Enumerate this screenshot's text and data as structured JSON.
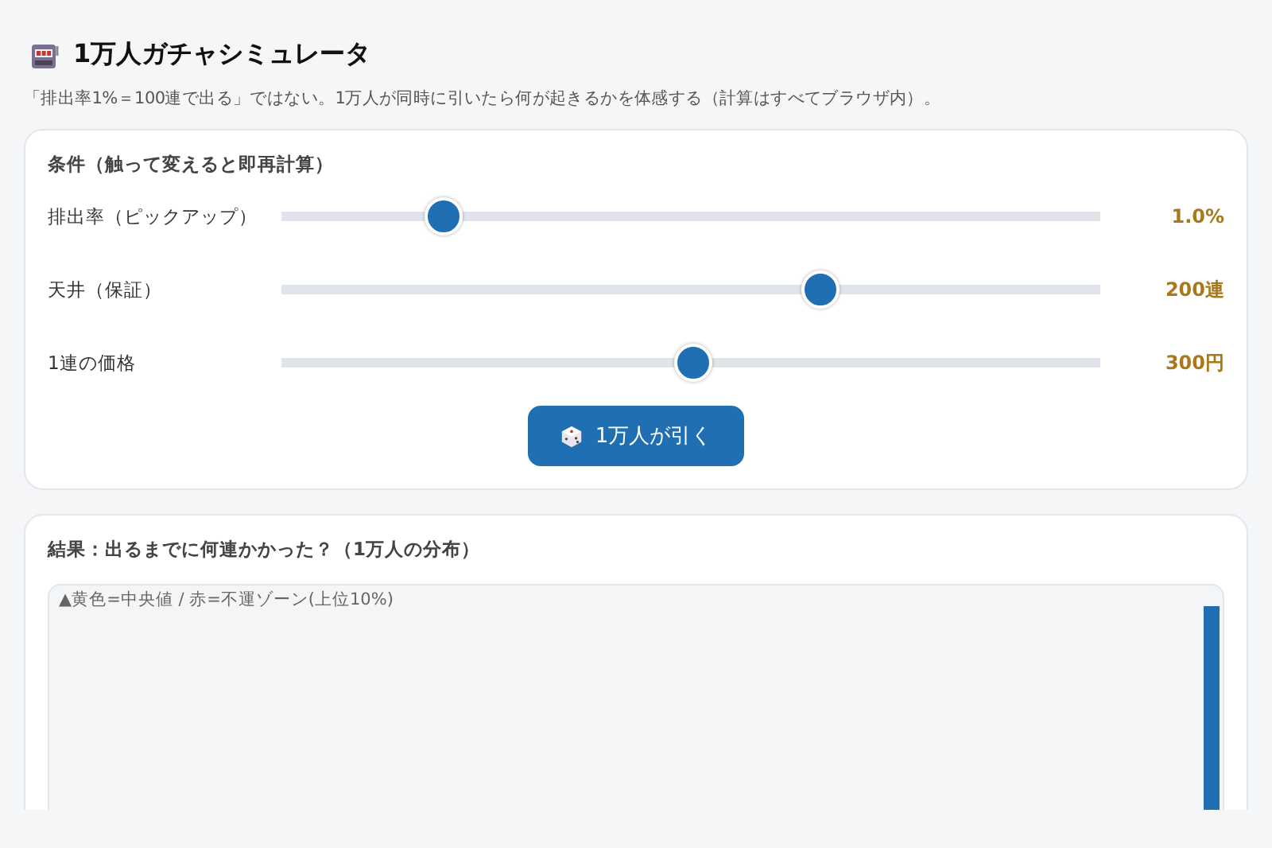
{
  "title": "1万人ガチャシミュレータ",
  "subtitle": "「排出率1%＝100連で出る」ではない。1万人が同時に引いたら何が起きるかを体感する（計算はすべてブラウザ内）。",
  "conditions": {
    "heading": "条件（触って変えると即再計算）",
    "sliders": [
      {
        "label": "排出率（ピックアップ）",
        "level": 0.198,
        "reading": "1.0%"
      },
      {
        "label": "天井（保証）",
        "level": 0.658,
        "reading": "200連"
      },
      {
        "label": "1連の価格",
        "level": 0.502,
        "reading": "300円"
      }
    ],
    "button": "1万人が引く"
  },
  "result": {
    "heading": "結果：出るまでに何連かかった？（1万人の分布）",
    "legend": "▲黄色=中央値 / 赤=不運ゾーン(上位10%)"
  }
}
